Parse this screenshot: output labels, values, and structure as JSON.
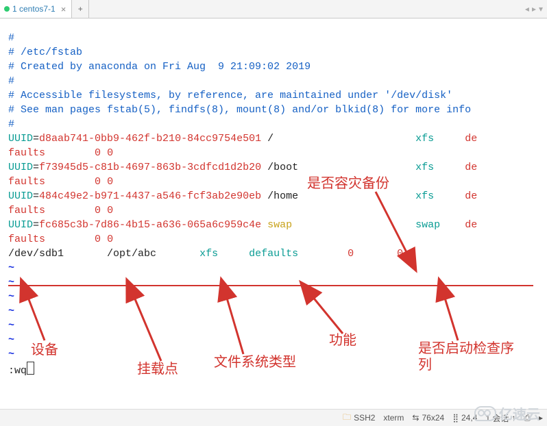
{
  "tab": {
    "title": "1 centos7-1",
    "close_glyph": "×",
    "new_glyph": "+"
  },
  "nav": {
    "left": "◂",
    "right": "▸",
    "menu": "▾"
  },
  "fstab": {
    "c1": "#",
    "c2": "# /etc/fstab",
    "c3": "# Created by anaconda on Fri Aug  9 21:09:02 2019",
    "c4": "#",
    "c5": "# Accessible filesystems, by reference, are maintained under '/dev/disk'",
    "c6": "# See man pages fstab(5), findfs(8), mount(8) and/or blkid(8) for more info",
    "c7": "#",
    "entries": [
      {
        "uuid": "d8aab741-0bb9-462f-b210-84cc9754e501",
        "mount": "/",
        "fs": "xfs",
        "opts": "defaults",
        "d1": "0",
        "d2": "0"
      },
      {
        "uuid": "f73945d5-c81b-4697-863b-3cdfcd1d2b20",
        "mount": "/boot",
        "fs": "xfs",
        "opts": "defaults",
        "d1": "0",
        "d2": "0"
      },
      {
        "uuid": "484c49e2-b971-4437-a546-fcf3ab2e90eb",
        "mount": "/home",
        "fs": "xfs",
        "opts": "defaults",
        "d1": "0",
        "d2": "0"
      },
      {
        "uuid": "fc685c3b-7d86-4b15-a636-065a6c959c4e",
        "mount": "swap",
        "fs": "swap",
        "opts": "defaults",
        "d1": "0",
        "d2": "0"
      }
    ],
    "newline": {
      "dev": "/dev/sdb1",
      "mount": "/opt/abc",
      "fs": "xfs",
      "opts": "defaults",
      "d1": "0",
      "d2": "0"
    },
    "uuid_kw": "UUID",
    "eq": "=",
    "faults": "faults",
    "de": "de"
  },
  "vim": {
    "tilde": "~",
    "cmd": ":wq"
  },
  "annotations": {
    "backup": "是否容灾备份",
    "device": "设备",
    "mount": "挂载点",
    "fstype": "文件系统类型",
    "feature": "功能",
    "check": "是否启动检查序列"
  },
  "status": {
    "proto": "SSH2",
    "term": "xterm",
    "size": "76x24",
    "pos": "24,4",
    "sess": "1 会话",
    "size_glyph": "⇆",
    "pos_glyph": "⣿",
    "sess_arrow": "↑",
    "cap": "⎙",
    "end": "▸"
  },
  "watermark": "亿速云"
}
